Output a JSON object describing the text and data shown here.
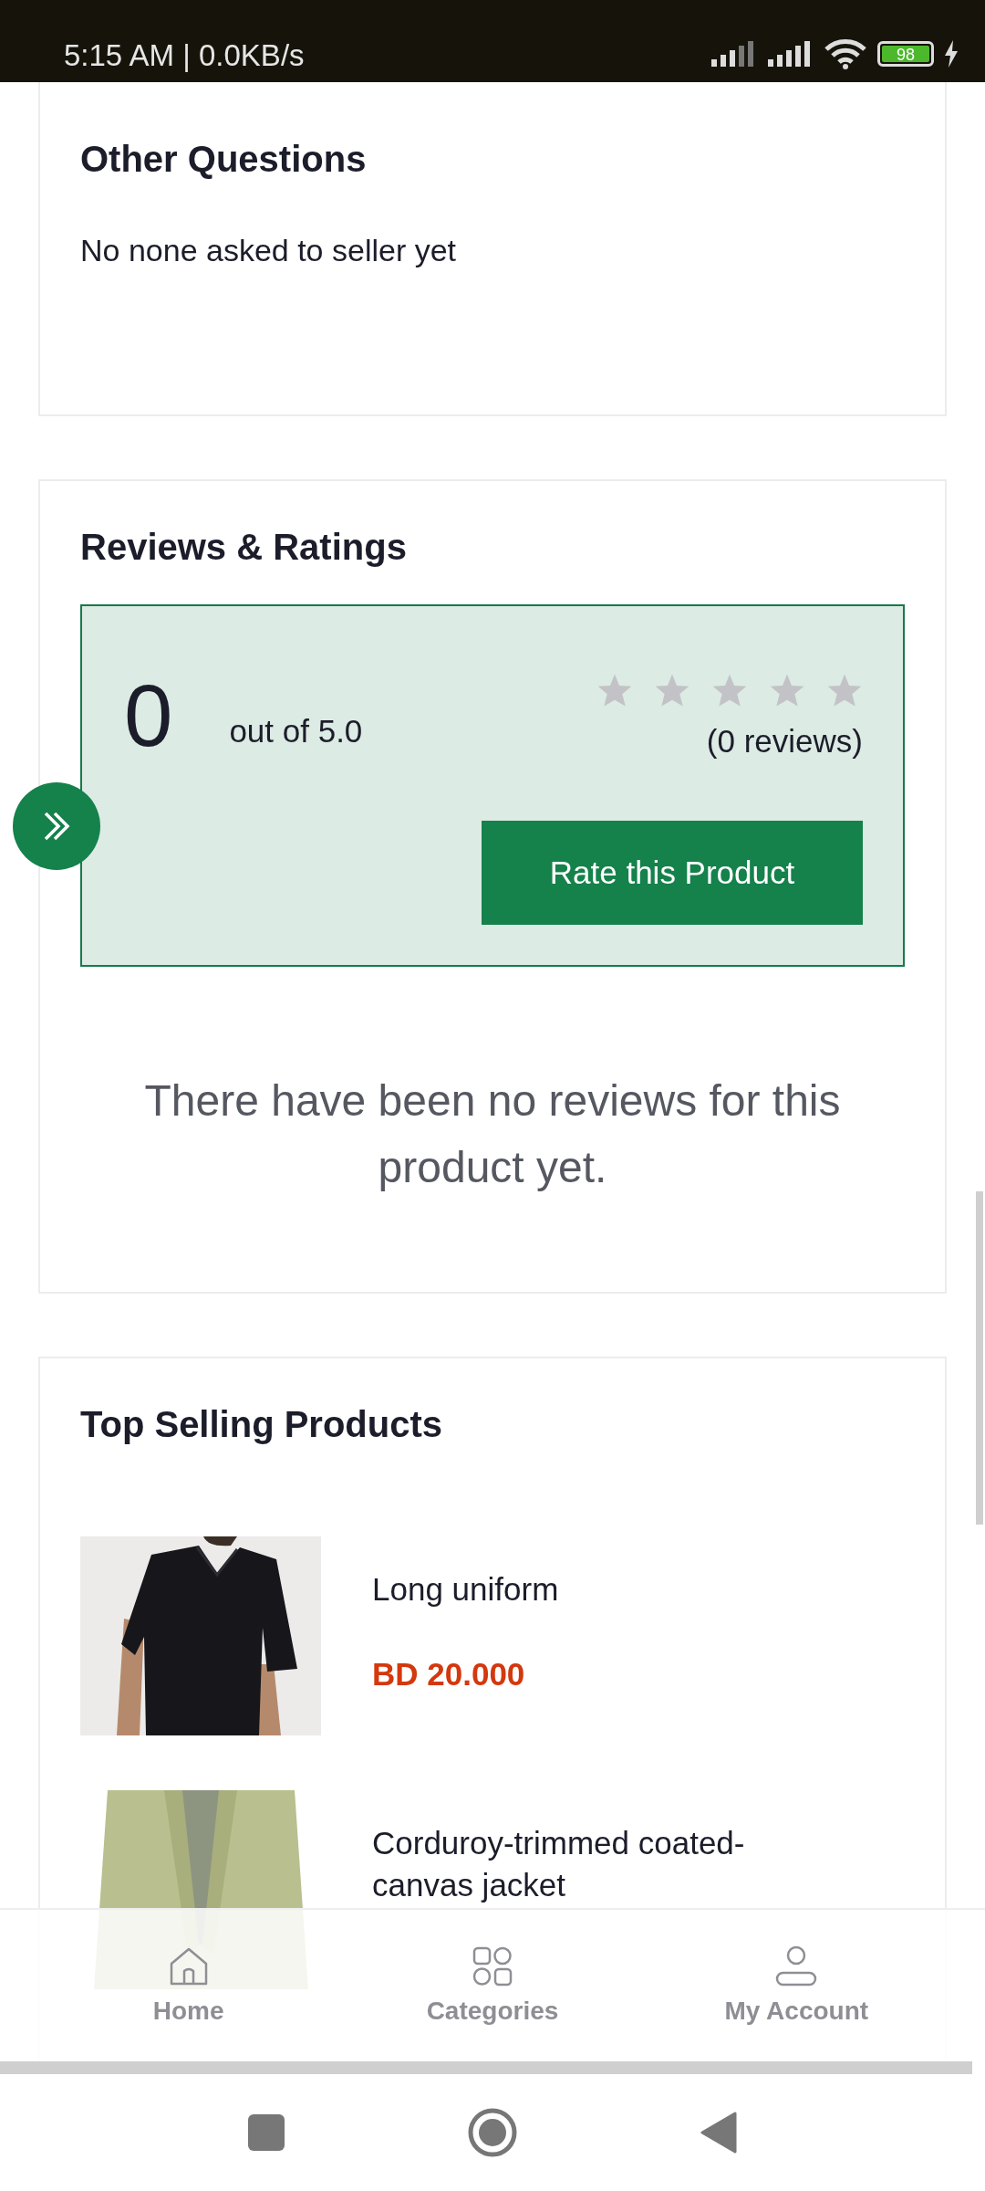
{
  "status_bar": {
    "time_speed": "5:15 AM | 0.0KB/s",
    "battery": "98"
  },
  "questions": {
    "title": "Other Questions",
    "message": "No none asked to seller yet"
  },
  "reviews": {
    "title": "Reviews & Ratings",
    "score": "0",
    "out_of": "out of 5.0",
    "stars": 0,
    "count": "(0 reviews)",
    "button": "Rate this Product",
    "empty_message": "There have been no reviews for this product yet."
  },
  "top_selling": {
    "title": "Top Selling Products",
    "products": [
      {
        "kind": "single",
        "name": "Long uniform",
        "price": "BD 20.000"
      },
      {
        "kind": "range",
        "name": "Corduroy-trimmed coated-canvas jacket"
      }
    ]
  },
  "bottom_nav": [
    {
      "kind": "home",
      "label": "Home",
      "selected": false
    },
    {
      "kind": "categories",
      "label": "Categories",
      "selected": false
    },
    {
      "kind": "account",
      "label": "My Account",
      "selected": false
    }
  ]
}
